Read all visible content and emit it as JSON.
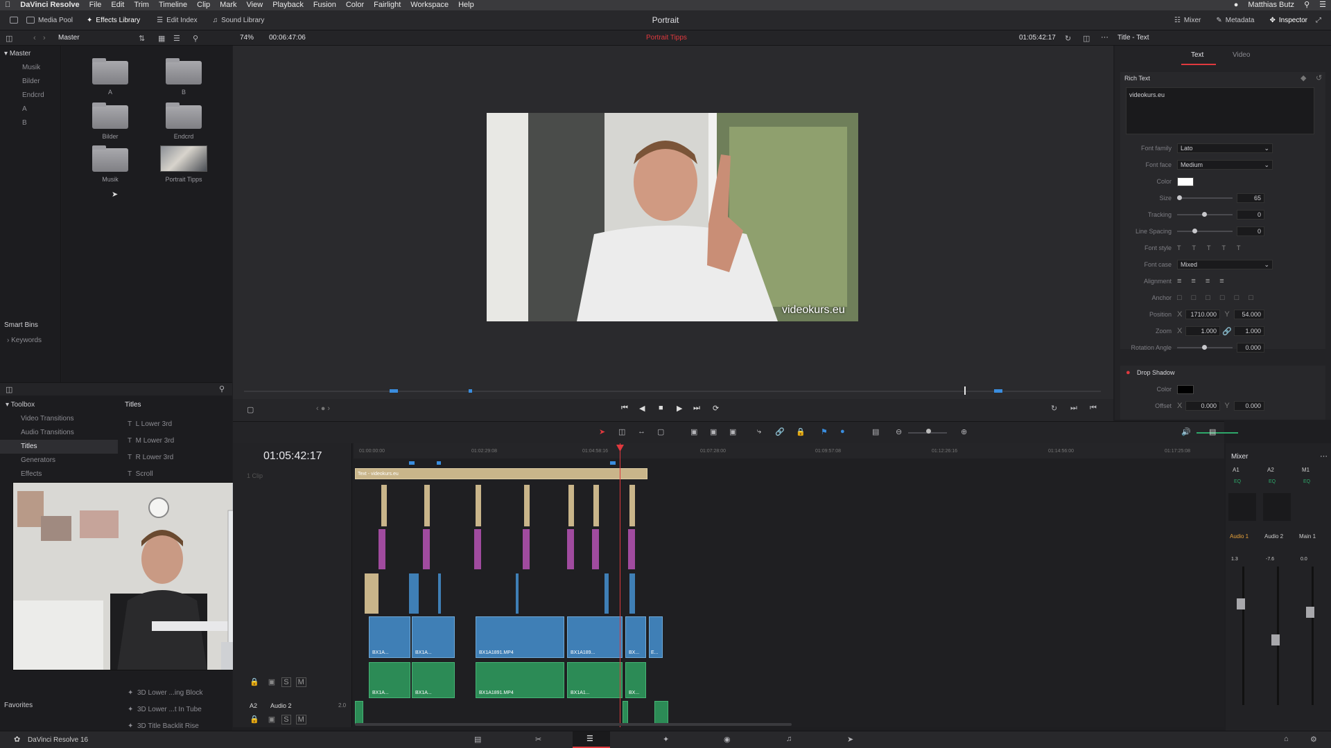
{
  "menubar": {
    "app": "DaVinci Resolve",
    "items": [
      "File",
      "Edit",
      "Trim",
      "Timeline",
      "Clip",
      "Mark",
      "View",
      "Playback",
      "Fusion",
      "Color",
      "Fairlight",
      "Workspace",
      "Help"
    ],
    "user": "Matthias Butz"
  },
  "toolbar": {
    "media_pool": "Media Pool",
    "effects_library": "Effects Library",
    "edit_index": "Edit Index",
    "sound_library": "Sound Library",
    "project_title": "Portrait",
    "mixer": "Mixer",
    "metadata": "Metadata",
    "inspector": "Inspector"
  },
  "toolbar2": {
    "bin": "Master",
    "zoom": "74%",
    "source_tc": "00:06:47:06",
    "timeline_name": "Portrait Tipps",
    "record_tc": "01:05:42:17",
    "inspector_title": "Title - Text"
  },
  "bins": {
    "master": "Master",
    "items": [
      "Musik",
      "Bilder",
      "Endcrd",
      "A",
      "B"
    ],
    "smart_bins": "Smart Bins",
    "keywords": "Keywords",
    "favorites": "Favorites"
  },
  "pool": {
    "items": [
      {
        "name": "A"
      },
      {
        "name": "B"
      },
      {
        "name": "Bilder"
      },
      {
        "name": "Endcrd"
      },
      {
        "name": "Musik"
      },
      {
        "name": "Portrait Tipps"
      }
    ]
  },
  "toolbox": {
    "items": [
      "Toolbox",
      "Video Transitions",
      "Audio Transitions",
      "Titles",
      "Generators",
      "Effects"
    ],
    "titles_header": "Titles",
    "titles": [
      "L Lower 3rd",
      "M Lower 3rd",
      "R Lower 3rd",
      "Scroll"
    ],
    "fusion_titles": [
      "3D Lower ...ing Block",
      "3D Lower ...t In Tube",
      "3D Title Backlit Rise"
    ]
  },
  "viewer": {
    "watermark": "videokurs.eu"
  },
  "inspector": {
    "tabs": [
      "Text",
      "Video"
    ],
    "rich_text": "Rich Text",
    "text_value": "videokurs.eu",
    "font_family_label": "Font family",
    "font_family": "Lato",
    "font_face_label": "Font face",
    "font_face": "Medium",
    "color_label": "Color",
    "size_label": "Size",
    "size": "65",
    "tracking_label": "Tracking",
    "tracking": "0",
    "line_spacing_label": "Line Spacing",
    "line_spacing": "0",
    "font_style_label": "Font style",
    "font_case_label": "Font case",
    "font_case": "Mixed",
    "alignment_label": "Alignment",
    "anchor_label": "Anchor",
    "position_label": "Position",
    "pos_x": "1710.000",
    "pos_y": "54.000",
    "zoom_label": "Zoom",
    "zoom_x": "1.000",
    "zoom_y": "1.000",
    "rotation_label": "Rotation Angle",
    "rotation": "0.000",
    "drop_shadow": "Drop Shadow",
    "ds_color_label": "Color",
    "offset_label": "Offset",
    "offset_x": "0.000",
    "offset_y": "0.000",
    "x": "X",
    "y": "Y"
  },
  "timeline": {
    "timecode": "01:05:42:17",
    "ruler": [
      "01:00:00:00",
      "01:02:29:08",
      "01:04:58:16",
      "01:07:28:00",
      "01:09:57:08",
      "01:12:26:16",
      "01:14:56:00",
      "01:17:25:08"
    ],
    "title_clip": "Text - videokurs.eu",
    "video_clips": [
      "BX1A...",
      "BX1A...",
      "BX1A1891.MP4",
      "BX1A189...",
      "BX...",
      "E..."
    ],
    "audio_clips": [
      "BX1A...",
      "BX1A...",
      "BX1A1891.MP4",
      "BX1A1...",
      "BX..."
    ],
    "track_a2": "A2",
    "track_a2_name": "Audio 2",
    "track_a2_ch": "2.0",
    "clip_count": "1 Clip"
  },
  "mixer": {
    "title": "Mixer",
    "channels": [
      "A1",
      "A2",
      "M1"
    ],
    "eq": "EQ",
    "names": [
      "Audio 1",
      "Audio 2",
      "Main 1"
    ],
    "levels": [
      "1.3",
      "-7.6",
      "0.0"
    ],
    "s": "S",
    "m": "M"
  },
  "status": {
    "app": "DaVinci Resolve 16"
  },
  "colors": {
    "accent_red": "#e0393e",
    "video_clip": "#3f7fb6",
    "audio_clip": "#2c8b56",
    "title_clip": "#c9b58a",
    "playhead": "#e0393e"
  }
}
